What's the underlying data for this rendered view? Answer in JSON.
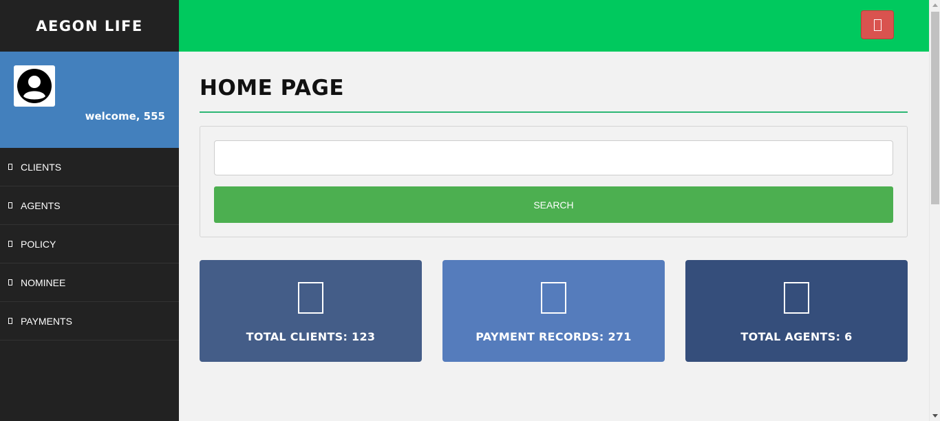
{
  "brand": "AEGON LIFE",
  "profile": {
    "welcome": "welcome, 555",
    "avatar_icon": "user-avatar-icon"
  },
  "sidebar": {
    "items": [
      {
        "label": "CLIENTS",
        "icon": "square-icon"
      },
      {
        "label": "AGENTS",
        "icon": "square-icon"
      },
      {
        "label": "POLICY",
        "icon": "square-icon"
      },
      {
        "label": "NOMINEE",
        "icon": "square-icon"
      },
      {
        "label": "PAYMENTS",
        "icon": "square-icon"
      }
    ]
  },
  "topbar": {
    "logout_icon": "logout-icon"
  },
  "main": {
    "title": "HOME PAGE",
    "search": {
      "value": "",
      "button_label": "SEARCH"
    },
    "cards": [
      {
        "label": "TOTAL CLIENTS: 123",
        "color": "#445d88"
      },
      {
        "label": "PAYMENT RECORDS: 271",
        "color": "#557cbc"
      },
      {
        "label": "TOTAL AGENTS: 6",
        "color": "#354e7b"
      }
    ]
  },
  "colors": {
    "sidebar_bg": "#222222",
    "profile_bg": "#4380bd",
    "topbar_bg": "#00c95e",
    "logout_bg": "#d9534f",
    "search_button_bg": "#4caf50",
    "title_rule": "#2bb673"
  }
}
